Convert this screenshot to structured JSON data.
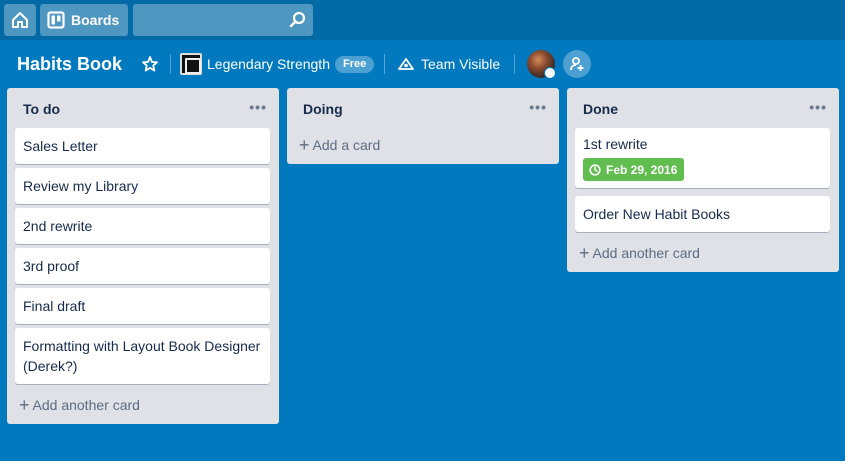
{
  "topbar": {
    "boards_label": "Boards",
    "search_value": ""
  },
  "board": {
    "title": "Habits Book",
    "team_name": "Legendary Strength",
    "plan_badge": "Free",
    "visibility": "Team Visible"
  },
  "lists": [
    {
      "title": "To do",
      "cards": [
        "Sales Letter",
        "Review my Library",
        "2nd rewrite",
        "3rd proof",
        "Final draft",
        "Formatting with Layout Book Designer (Derek?)"
      ],
      "add_label": "Add another card"
    },
    {
      "title": "Doing",
      "cards": [],
      "add_label": "Add a card"
    },
    {
      "title": "Done",
      "cards": [
        "1st rewrite",
        "Order New Habit Books"
      ],
      "due_date": "Feb 29, 2016",
      "add_label": "Add another card"
    }
  ],
  "colors": {
    "board_bg": "#0079bf",
    "topbar_bg": "#026aa7",
    "list_bg": "#dfe1e6",
    "due_complete": "#61bd4f"
  },
  "icons": [
    "home-icon",
    "boards-icon",
    "search-icon",
    "star-icon",
    "visibility-icon",
    "add-member-icon",
    "clock-icon"
  ]
}
